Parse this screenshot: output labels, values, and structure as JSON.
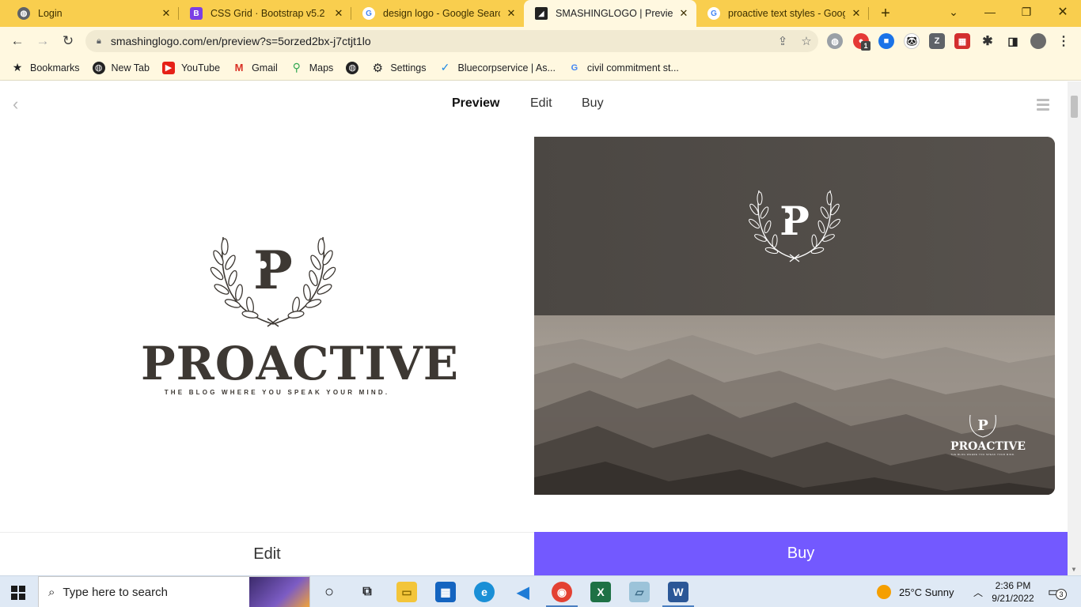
{
  "browser": {
    "tabs": [
      {
        "title": "Login",
        "favicon": "globe",
        "active": false
      },
      {
        "title": "CSS Grid · Bootstrap v5.2",
        "favicon": "B",
        "active": false
      },
      {
        "title": "design logo - Google Search",
        "favicon": "G",
        "active": false
      },
      {
        "title": "SMASHINGLOGO | Preview",
        "favicon": "smashinglogo",
        "active": true
      },
      {
        "title": "proactive text styles - Google",
        "favicon": "G",
        "active": false
      }
    ],
    "new_tab_label": "+",
    "url": "smashinglogo.com/en/preview?s=5orzed2bx-j7ctjt1lo",
    "extension_badge": "1"
  },
  "bookmarks": [
    {
      "label": "Bookmarks",
      "icon": "star-icon"
    },
    {
      "label": "New Tab",
      "icon": "globe-icon"
    },
    {
      "label": "YouTube",
      "icon": "youtube-icon"
    },
    {
      "label": "Gmail",
      "icon": "gmail-icon"
    },
    {
      "label": "Maps",
      "icon": "maps-icon"
    },
    {
      "label": "",
      "icon": "globe-icon"
    },
    {
      "label": "Settings",
      "icon": "gear-icon"
    },
    {
      "label": "Bluecorpservice | As...",
      "icon": "bluecorp-icon"
    },
    {
      "label": "civil commitment st...",
      "icon": "google-icon"
    }
  ],
  "nav": {
    "links": [
      "Preview",
      "Edit",
      "Buy"
    ],
    "active": "Preview"
  },
  "logo": {
    "monogram": "P",
    "wordmark": "PROACTIVE",
    "tagline": "THE BLOG WHERE YOU SPEAK YOUR MIND."
  },
  "actions": {
    "edit_label": "Edit",
    "buy_label": "Buy"
  },
  "colors": {
    "tab_strip": "#f9ce4e",
    "buy_button": "#7359ff",
    "logo_dark": "#3d3833"
  },
  "taskbar": {
    "search_placeholder": "Type here to search",
    "weather": "25°C  Sunny",
    "time": "2:36 PM",
    "date": "9/21/2022",
    "notifications": "3"
  }
}
